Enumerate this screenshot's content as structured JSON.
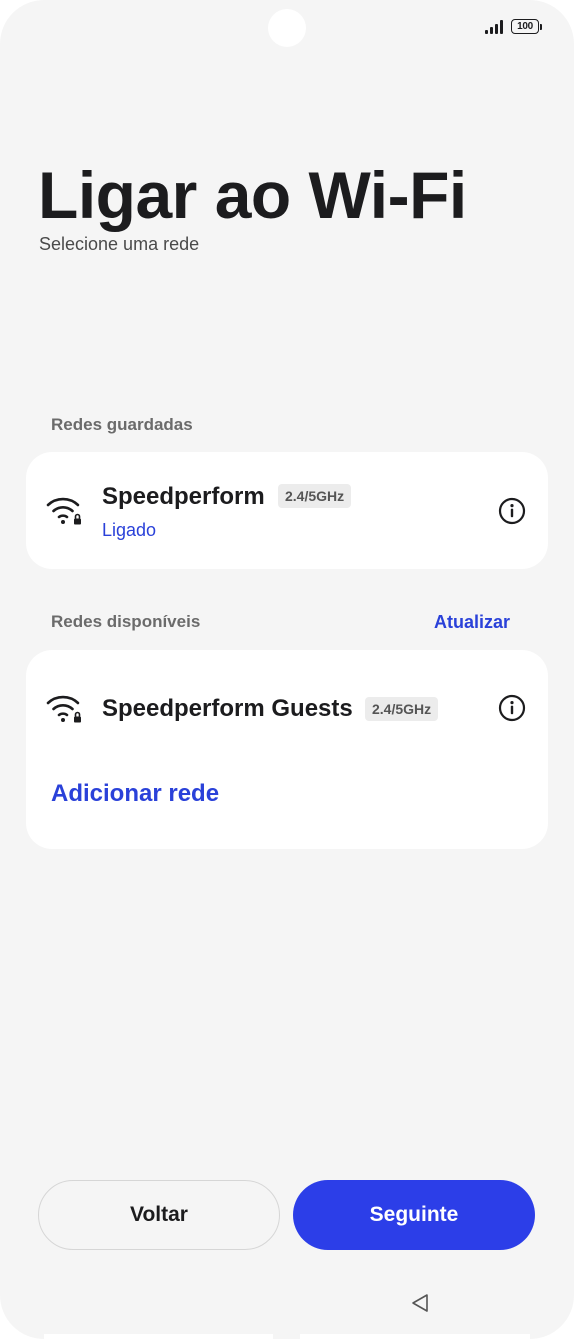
{
  "status_bar": {
    "battery_level": "100"
  },
  "header": {
    "title": "Ligar ao Wi-Fi",
    "subtitle": "Selecione uma rede"
  },
  "saved_networks": {
    "section_label": "Redes guardadas",
    "items": [
      {
        "name": "Speedperform",
        "band": "2.4/5GHz",
        "status": "Ligado",
        "icon": "wifi-locked-icon"
      }
    ]
  },
  "available_networks": {
    "section_label": "Redes disponíveis",
    "refresh_label": "Atualizar",
    "items": [
      {
        "name": "Speedperform Guests",
        "band": "2.4/5GHz",
        "icon": "wifi-locked-icon"
      }
    ],
    "add_network_label": "Adicionar rede"
  },
  "footer": {
    "back_label": "Voltar",
    "next_label": "Seguinte"
  },
  "colors": {
    "accent": "#2a41d9",
    "primary_button": "#2c3ee8",
    "background": "#f5f5f5",
    "card": "#ffffff"
  },
  "icons": {
    "info": "info-icon",
    "nav_back": "nav-back-triangle-icon",
    "signal": "signal-icon",
    "battery": "battery-icon"
  }
}
